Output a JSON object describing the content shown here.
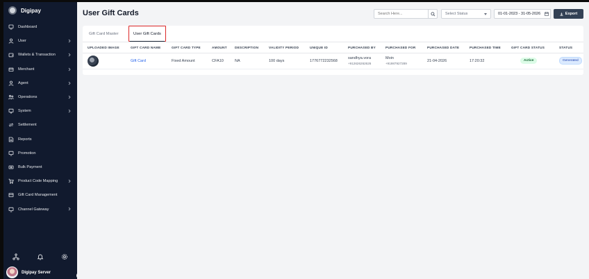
{
  "app": {
    "name": "Digipay"
  },
  "sidebar": {
    "items": [
      {
        "label": "Dashboard",
        "icon": "dashboard-icon",
        "chevron": false
      },
      {
        "label": "User",
        "icon": "user-icon",
        "chevron": true
      },
      {
        "label": "Wallets & Transaction",
        "icon": "wallet-icon",
        "chevron": true
      },
      {
        "label": "Merchant",
        "icon": "merchant-icon",
        "chevron": true
      },
      {
        "label": "Agent",
        "icon": "agent-icon",
        "chevron": true
      },
      {
        "label": "Operations",
        "icon": "operations-icon",
        "chevron": true
      },
      {
        "label": "System",
        "icon": "monitor-icon",
        "chevron": true
      },
      {
        "label": "Settlement",
        "icon": "settlement-icon",
        "chevron": false
      },
      {
        "label": "Reports",
        "icon": "reports-icon",
        "chevron": false
      },
      {
        "label": "Promotion",
        "icon": "promotion-icon",
        "chevron": false
      },
      {
        "label": "Bulk Payment",
        "icon": "bulk-payment-icon",
        "chevron": false
      },
      {
        "label": "Product Code Mapping",
        "icon": "cart-icon",
        "chevron": true
      },
      {
        "label": "Gift Card Management",
        "icon": "gift-card-icon",
        "chevron": false
      },
      {
        "label": "Channel Gateway",
        "icon": "channel-icon",
        "chevron": true
      }
    ],
    "user_name": "Digipay Server"
  },
  "header": {
    "title": "User Gift Cards",
    "search_placeholder": "Search Here...",
    "status_placeholder": "Select Status",
    "date_range": "01-01-2023 - 31-05-2026",
    "export_label": "Export"
  },
  "tabs": [
    {
      "label": "Gift Card Master",
      "active": false
    },
    {
      "label": "User Gift Cards",
      "active": true
    }
  ],
  "table": {
    "columns": [
      "UPLOADED IMAGE",
      "GIFT CARD NAME",
      "GIFT CARD TYPE",
      "AMOUNT",
      "DESCRIPTION",
      "VALIDITY PERIOD",
      "UNIQUE ID",
      "PURCHASED BY",
      "PURCHASED FOR",
      "PURCHASED DATE",
      "PURCHASED TIME",
      "GIFT CARD STATUS",
      "STATUS"
    ],
    "rows": [
      {
        "name": "Gift Card",
        "type": "Fixed Amount",
        "amount": "CFA10",
        "description": "NA",
        "validity": "100 days",
        "unique_id": "1776772232568",
        "purchased_by_name": "sandhya.vora",
        "purchased_by_phone": "+912626262626",
        "purchased_for_name": "Moin",
        "purchased_for_phone": "+91987927289",
        "date": "21-04-2026",
        "time": "17:20:32",
        "gift_card_status": "Active",
        "status": "Generated"
      }
    ]
  },
  "colors": {
    "sidebar_bg": "#111a2e",
    "accent_red": "#dc2626",
    "link": "#2563eb",
    "export_bg": "#334155"
  }
}
